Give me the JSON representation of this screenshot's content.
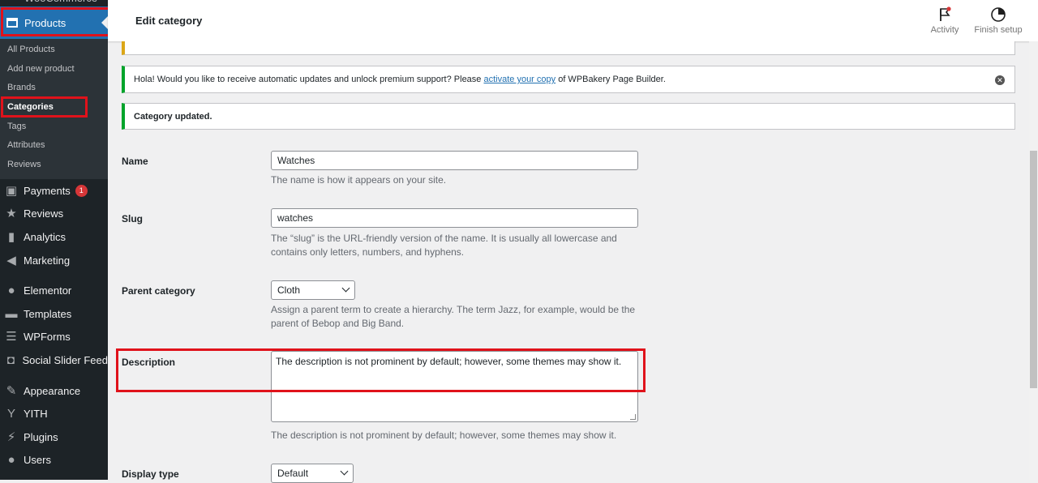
{
  "sidebar": {
    "top_item": "WooCommerce",
    "products_label": "Products",
    "submenu": [
      "All Products",
      "Add new product",
      "Brands",
      "Categories",
      "Tags",
      "Attributes",
      "Reviews"
    ],
    "items": [
      {
        "label": "Payments",
        "icon": "payments-icon",
        "badge": "1"
      },
      {
        "label": "Reviews",
        "icon": "star-icon"
      },
      {
        "label": "Analytics",
        "icon": "bar-chart-icon"
      },
      {
        "label": "Marketing",
        "icon": "megaphone-icon"
      },
      {
        "label": "Elementor",
        "icon": "elementor-icon"
      },
      {
        "label": "Templates",
        "icon": "folder-icon"
      },
      {
        "label": "WPForms",
        "icon": "form-icon"
      },
      {
        "label": "Social Slider Feed",
        "icon": "instagram-icon"
      },
      {
        "label": "Appearance",
        "icon": "paintbrush-icon"
      },
      {
        "label": "YITH",
        "icon": "yith-icon"
      },
      {
        "label": "Plugins",
        "icon": "plug-icon"
      },
      {
        "label": "Users",
        "icon": "user-icon"
      }
    ]
  },
  "topbar": {
    "title": "Edit category",
    "activity": "Activity",
    "finish_setup": "Finish setup"
  },
  "notices": {
    "wpbakery_prefix": "Hola! Would you like to receive automatic updates and unlock premium support? Please",
    "wpbakery_link": "activate your copy",
    "wpbakery_suffix": "of WPBakery Page Builder.",
    "updated": "Category updated."
  },
  "form": {
    "name_label": "Name",
    "name_value": "Watches",
    "name_help": "The name is how it appears on your site.",
    "slug_label": "Slug",
    "slug_value": "watches",
    "slug_help_1": "The “slug” is the URL-friendly version of the name. It is usually all lowercase and",
    "slug_help_2": "contains only letters, numbers, and hyphens.",
    "parent_label": "Parent category",
    "parent_value": "Cloth",
    "parent_help_1": "Assign a parent term to create a hierarchy. The term Jazz, for example, would be the",
    "parent_help_2": "parent of Bebop and Big Band.",
    "description_label": "Description",
    "description_value": "The description is not prominent by default; however, some themes may show it.",
    "description_help": "The description is not prominent by default; however, some themes may show it.",
    "display_type_label": "Display type",
    "display_type_value": "Default"
  },
  "colors": {
    "sidebar_bg": "#1d2327",
    "accent": "#2271b1",
    "success": "#00a32a",
    "highlight": "#e0121b"
  }
}
